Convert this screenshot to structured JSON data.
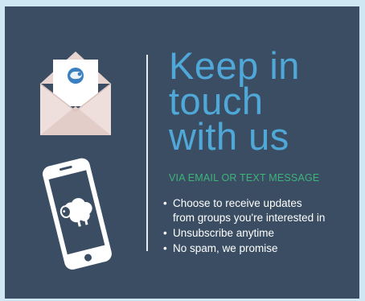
{
  "headline": {
    "line1": "Keep in",
    "line2": "touch",
    "line3": "with us"
  },
  "subheading": "VIA EMAIL OR TEXT MESSAGE",
  "bullets": [
    {
      "line1": "Choose to receive updates",
      "line2": "from groups you're interested in"
    },
    {
      "line1": "Unsubscribe anytime"
    },
    {
      "line1": "No spam, we promise"
    }
  ],
  "colors": {
    "panel_background": "#3a4d63",
    "outer_background": "#cfe7f3",
    "headline": "#4fa8d8",
    "subheading": "#3fb47a",
    "envelope": "#ecdcd9",
    "sheep_badge": "#3a7fc0"
  },
  "icons": {
    "envelope": "envelope-open-icon",
    "phone": "smartphone-icon",
    "sheep": "sheep-icon"
  }
}
